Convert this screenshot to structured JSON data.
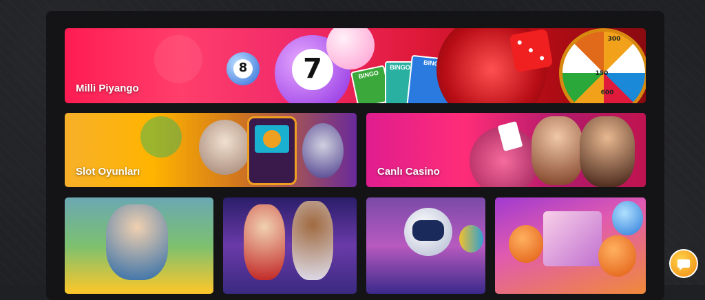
{
  "tiles": {
    "milli_piyango": {
      "label": "Milli Piyango"
    },
    "slot_oyunlari": {
      "label": "Slot Oyunları"
    },
    "canli_casino": {
      "label": "Canlı Casino"
    }
  },
  "decor": {
    "ball_numbers": [
      "8",
      "7"
    ],
    "bingo_cards": [
      "BINGO",
      "BINGO",
      "BINGO"
    ],
    "wheel_numbers": [
      "300",
      "150",
      "600"
    ]
  },
  "icons": {
    "chat": "chat-icon"
  }
}
